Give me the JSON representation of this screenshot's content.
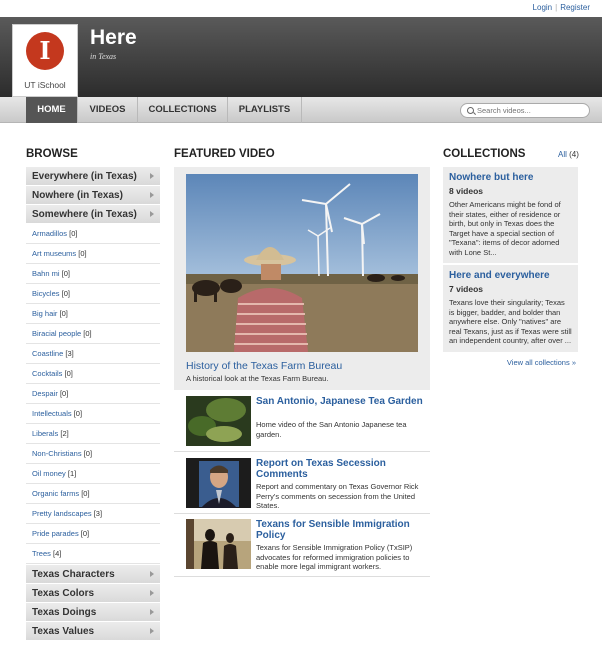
{
  "top_links": {
    "login": "Login",
    "register": "Register"
  },
  "header": {
    "logo_text": "UT iSchool",
    "title": "Here",
    "subtitle": "in Texas"
  },
  "nav": {
    "items": [
      {
        "label": "HOME",
        "active": true
      },
      {
        "label": "VIDEOS",
        "active": false
      },
      {
        "label": "COLLECTIONS",
        "active": false
      },
      {
        "label": "PLAYLISTS",
        "active": false
      }
    ],
    "search_placeholder": "Search videos..."
  },
  "browse": {
    "heading": "BROWSE",
    "top_categories": [
      "Everywhere (in Texas)",
      "Nowhere (in Texas)",
      "Somewhere (in Texas)"
    ],
    "tags": [
      {
        "name": "Armadillos",
        "count": "[0]"
      },
      {
        "name": "Art museums",
        "count": "[0]"
      },
      {
        "name": "Bahn mi",
        "count": "[0]"
      },
      {
        "name": "Bicycles",
        "count": "[0]"
      },
      {
        "name": "Big hair",
        "count": "[0]"
      },
      {
        "name": "Biracial people",
        "count": "[0]"
      },
      {
        "name": "Coastline",
        "count": "[3]"
      },
      {
        "name": "Cocktails",
        "count": "[0]"
      },
      {
        "name": "Despair",
        "count": "[0]"
      },
      {
        "name": "Intellectuals",
        "count": "[0]"
      },
      {
        "name": "Liberals",
        "count": "[2]"
      },
      {
        "name": "Non-Christians",
        "count": "[0]"
      },
      {
        "name": "Oil money",
        "count": "[1]"
      },
      {
        "name": "Organic farms",
        "count": "[0]"
      },
      {
        "name": "Pretty landscapes",
        "count": "[3]"
      },
      {
        "name": "Pride parades",
        "count": "[0]"
      },
      {
        "name": "Trees",
        "count": "[4]"
      }
    ],
    "bottom_categories": [
      "Texas Characters",
      "Texas Colors",
      "Texas Doings",
      "Texas Values"
    ]
  },
  "featured": {
    "heading": "FEATURED VIDEO",
    "main": {
      "title": "History of the Texas Farm Bureau",
      "description": "A historical look at the Texas Farm Bureau."
    },
    "videos": [
      {
        "title": "San Antonio, Japanese Tea Garden",
        "description": "Home video of the San Antonio Japanese tea garden.",
        "thumb": "garden"
      },
      {
        "title": "Report on Texas Secession Comments",
        "description": "Report and commentary on Texas Governor Rick Perry's comments on secession from the United States.",
        "thumb": "portrait"
      },
      {
        "title": "Texans for Sensible Immigration Policy",
        "description": "Texans for Sensible Immigration Policy (TxSIP) advocates for reformed immigration policies to enable more legal immigrant workers.",
        "thumb": "silhouette"
      }
    ]
  },
  "collections": {
    "heading": "COLLECTIONS",
    "all_label": "All",
    "all_count": "(4)",
    "items": [
      {
        "title": "Nowhere but here",
        "count": "8 videos",
        "description": "Other Americans might be fond of their states, either of residence or birth, but only in Texas does the Target have a special section of \"Texana\": items of decor adorned with Lone St..."
      },
      {
        "title": "Here and everywhere",
        "count": "7 videos",
        "description": "Texans love their singularity; Texas is bigger, badder, and bolder than anywhere else. Only \"natives\" are real Texans, just as if Texas were still an independent country, after over ..."
      }
    ],
    "view_all": "View all collections »"
  }
}
